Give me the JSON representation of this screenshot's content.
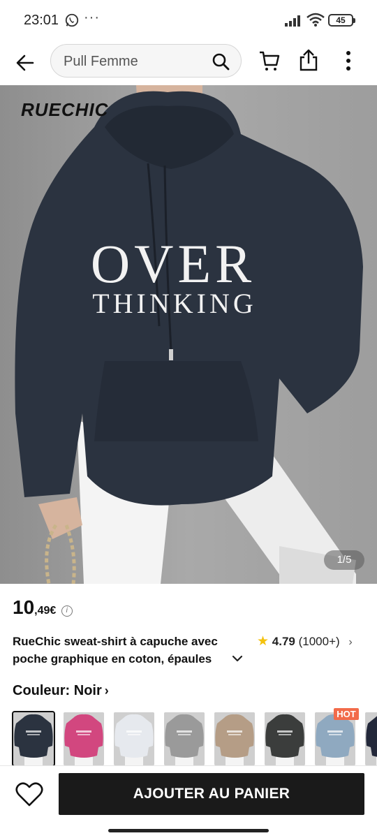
{
  "status_bar": {
    "time": "23:01",
    "dots": "···",
    "battery": "45",
    "icons": [
      "whatsapp-icon",
      "signal-icon",
      "wifi-icon",
      "battery-icon"
    ]
  },
  "header": {
    "search_value": "Pull Femme",
    "icons": [
      "back-arrow-icon",
      "search-icon",
      "cart-icon",
      "share-icon",
      "more-vertical-icon"
    ]
  },
  "product": {
    "brand_logo": "RUECHIC",
    "print_line1": "OVER",
    "print_line2": "THINKING",
    "image_counter": "1/5",
    "price_main": "10",
    "price_cents": ",49€",
    "price_info_icon": "i",
    "title": "RueChic sweat-shirt à capuche avec poche graphique en coton, épaules tombantes",
    "rating_score": "4.79",
    "rating_count": "(1000+)",
    "rating_chevron": "›",
    "color_label": "Couleur: Noir",
    "color_chevron": "›",
    "hot_badge": "HOT"
  },
  "swatches": [
    {
      "name": "Noir",
      "color": "#2b3340",
      "selected": true
    },
    {
      "name": "Rose",
      "color": "#d2477f",
      "selected": false
    },
    {
      "name": "Papillon",
      "color": "#e6e9ee",
      "selected": false
    },
    {
      "name": "Gris",
      "color": "#9a9a9a",
      "selected": false
    },
    {
      "name": "Kaki",
      "color": "#b59d86",
      "selected": false
    },
    {
      "name": "Gris foncé",
      "color": "#3b3d3c",
      "selected": false
    },
    {
      "name": "Bleu clair",
      "color": "#8fa9c0",
      "selected": false
    },
    {
      "name": "Marine",
      "color": "#23283a",
      "selected": false
    }
  ],
  "bottom_bar": {
    "add_to_cart": "AJOUTER AU PANIER"
  },
  "colors": {
    "accent_dark": "#1a1a1a",
    "hot": "#f26b4a",
    "star": "#f4c20d",
    "hoodie": "#2b3340"
  }
}
